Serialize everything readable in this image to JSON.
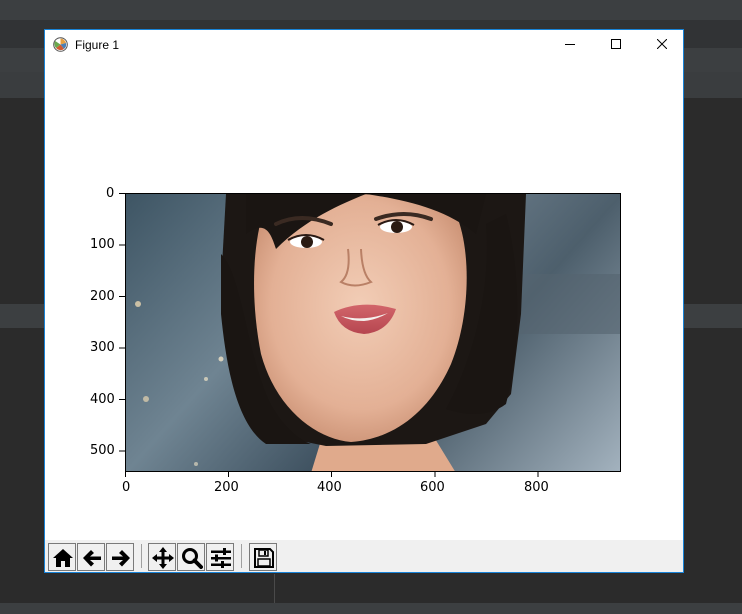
{
  "window": {
    "title": "Figure 1",
    "app_icon": "matplotlib-icon",
    "controls": [
      "minimize-icon",
      "maximize-icon",
      "close-icon"
    ]
  },
  "chart_data": {
    "type": "image",
    "xlim": [
      0,
      960
    ],
    "ylim": [
      540,
      0
    ],
    "x_ticks": [
      "0",
      "200",
      "400",
      "600",
      "800"
    ],
    "y_ticks": [
      "0",
      "100",
      "200",
      "300",
      "400",
      "500"
    ]
  },
  "toolbar": {
    "buttons": [
      "home-icon",
      "back-arrow-icon",
      "forward-arrow-icon",
      "pan-icon",
      "zoom-icon",
      "subplots-config-icon",
      "save-icon"
    ]
  },
  "colors": {
    "window_border": "#1883d7",
    "toolbar_bg": "#f0f0f0",
    "ide_bg": "#2b2b2b"
  }
}
